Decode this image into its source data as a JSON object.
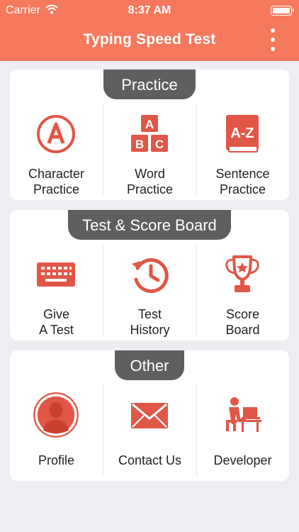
{
  "status_bar": {
    "carrier": "Carrier",
    "time": "8:37 AM"
  },
  "header": {
    "title": "Typing Speed Test"
  },
  "colors": {
    "accent": "#f7795d",
    "icon": "#e05747",
    "section_label_bg": "#5f5f5f",
    "background": "#eeedf2"
  },
  "sections": [
    {
      "title": "Practice",
      "items": [
        {
          "label": "Character\nPractice",
          "icon": "letter-a-icon"
        },
        {
          "label": "Word\nPractice",
          "icon": "abc-blocks-icon"
        },
        {
          "label": "Sentence\nPractice",
          "icon": "a-z-book-icon"
        }
      ]
    },
    {
      "title": "Test & Score Board",
      "items": [
        {
          "label": "Give\nA Test",
          "icon": "keyboard-icon"
        },
        {
          "label": "Test\nHistory",
          "icon": "history-icon"
        },
        {
          "label": "Score\nBoard",
          "icon": "trophy-icon"
        }
      ]
    },
    {
      "title": "Other",
      "items": [
        {
          "label": "Profile",
          "icon": "profile-avatar-icon"
        },
        {
          "label": "Contact Us",
          "icon": "envelope-icon"
        },
        {
          "label": "Developer",
          "icon": "developer-at-desk-icon"
        }
      ]
    }
  ]
}
